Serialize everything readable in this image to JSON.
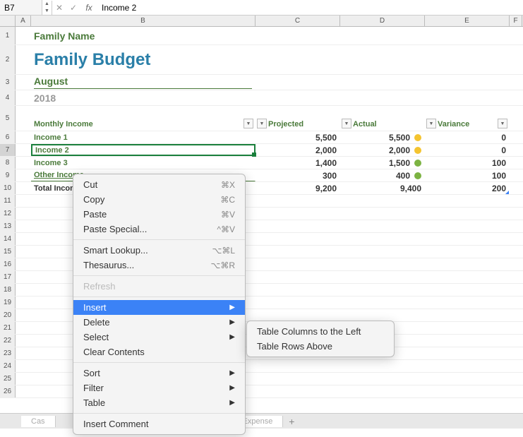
{
  "formula_bar": {
    "cell_ref": "B7",
    "fx_label": "fx",
    "value": "Income 2"
  },
  "columns": [
    "A",
    "B",
    "C",
    "D",
    "E",
    "F"
  ],
  "content": {
    "family_name": "Family Name",
    "budget_title": "Family Budget",
    "month": "August",
    "year": "2018",
    "section": "Monthly Income"
  },
  "table_headers": {
    "projected": "Projected",
    "actual": "Actual",
    "variance": "Variance"
  },
  "rows": [
    {
      "label": "Income 1",
      "projected": "5,500",
      "actual": "5,500",
      "variance": "0",
      "dot": "yellow"
    },
    {
      "label": "Income 2",
      "projected": "2,000",
      "actual": "2,000",
      "variance": "0",
      "dot": "yellow"
    },
    {
      "label": "Income 3",
      "projected": "1,400",
      "actual": "1,500",
      "variance": "100",
      "dot": "green"
    },
    {
      "label": "Other Income",
      "projected": "300",
      "actual": "400",
      "variance": "100",
      "dot": "green"
    }
  ],
  "total": {
    "label": "Total Income",
    "projected": "9,200",
    "actual": "9,400",
    "variance": "200"
  },
  "context_menu": {
    "cut": "Cut",
    "cut_key": "⌘X",
    "copy": "Copy",
    "copy_key": "⌘C",
    "paste": "Paste",
    "paste_key": "⌘V",
    "paste_special": "Paste Special...",
    "paste_special_key": "^⌘V",
    "smart_lookup": "Smart Lookup...",
    "smart_lookup_key": "⌥⌘L",
    "thesaurus": "Thesaurus...",
    "thesaurus_key": "⌥⌘R",
    "refresh": "Refresh",
    "insert": "Insert",
    "delete": "Delete",
    "select": "Select",
    "clear": "Clear Contents",
    "sort": "Sort",
    "filter": "Filter",
    "table": "Table",
    "insert_comment": "Insert Comment"
  },
  "submenu": {
    "cols_left": "Table Columns to the Left",
    "rows_above": "Table Rows Above"
  },
  "tabs": {
    "tab1": "Cas",
    "tab2": "ly Expense",
    "add": "+"
  },
  "row_numbers": [
    1,
    2,
    3,
    4,
    5,
    6,
    7,
    8,
    9,
    10,
    11,
    12,
    13,
    14,
    15,
    16,
    17,
    18,
    19,
    20,
    21,
    22,
    23,
    24,
    25,
    26
  ]
}
